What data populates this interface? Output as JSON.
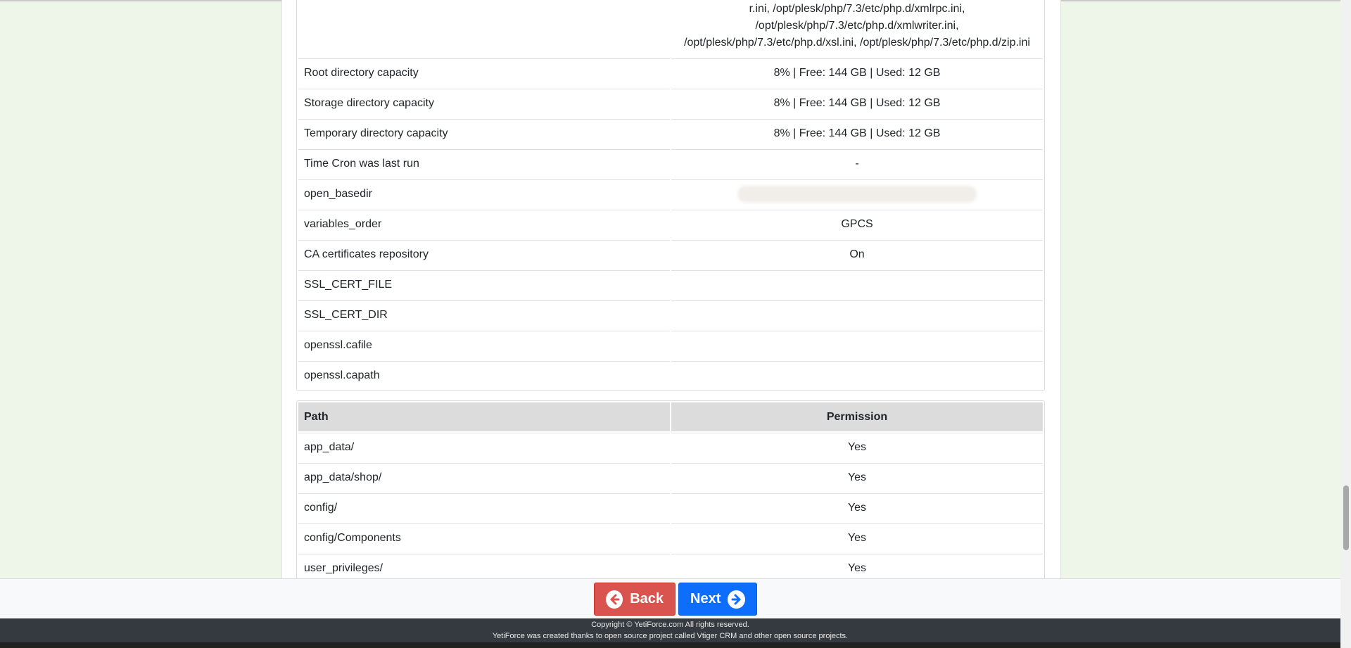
{
  "system_info": {
    "ini_files_tail": "r.ini, /opt/plesk/php/7.3/etc/php.d/xmlrpc.ini, /opt/plesk/php/7.3/etc/php.d/xmlwriter.ini, /opt/plesk/php/7.3/etc/php.d/xsl.ini, /opt/plesk/php/7.3/etc/php.d/zip.ini",
    "rows": [
      {
        "label": "Root directory capacity",
        "value": "8% | Free: 144 GB | Used: 12 GB"
      },
      {
        "label": "Storage directory capacity",
        "value": "8% | Free: 144 GB | Used: 12 GB"
      },
      {
        "label": "Temporary directory capacity",
        "value": "8% | Free: 144 GB | Used: 12 GB"
      },
      {
        "label": "Time Cron was last run",
        "value": "-"
      },
      {
        "label": "open_basedir",
        "value": ""
      },
      {
        "label": "variables_order",
        "value": "GPCS"
      },
      {
        "label": "CA certificates repository",
        "value": "On"
      },
      {
        "label": "SSL_CERT_FILE",
        "value": ""
      },
      {
        "label": "SSL_CERT_DIR",
        "value": ""
      },
      {
        "label": "openssl.cafile",
        "value": ""
      },
      {
        "label": "openssl.capath",
        "value": ""
      }
    ]
  },
  "permissions": {
    "headers": {
      "path": "Path",
      "permission": "Permission"
    },
    "rows": [
      {
        "path": "app_data/",
        "permission": "Yes"
      },
      {
        "path": "app_data/shop/",
        "permission": "Yes"
      },
      {
        "path": "config/",
        "permission": "Yes"
      },
      {
        "path": "config/Components",
        "permission": "Yes"
      },
      {
        "path": "user_privileges/",
        "permission": "Yes"
      }
    ]
  },
  "nav": {
    "back_label": "Back",
    "next_label": "Next",
    "back_icon": "arrow-circle-left-icon",
    "next_icon": "arrow-circle-right-icon"
  },
  "footer": {
    "copyright": "Copyright © YetiForce.com All rights reserved.",
    "credits": "YetiForce was created thanks to open source project called Vtiger CRM and other open source projects."
  },
  "colors": {
    "back": "#d9534f",
    "next": "#0d6efd",
    "footer_dark": "#343a40",
    "page_bg": "#eef5e9"
  }
}
